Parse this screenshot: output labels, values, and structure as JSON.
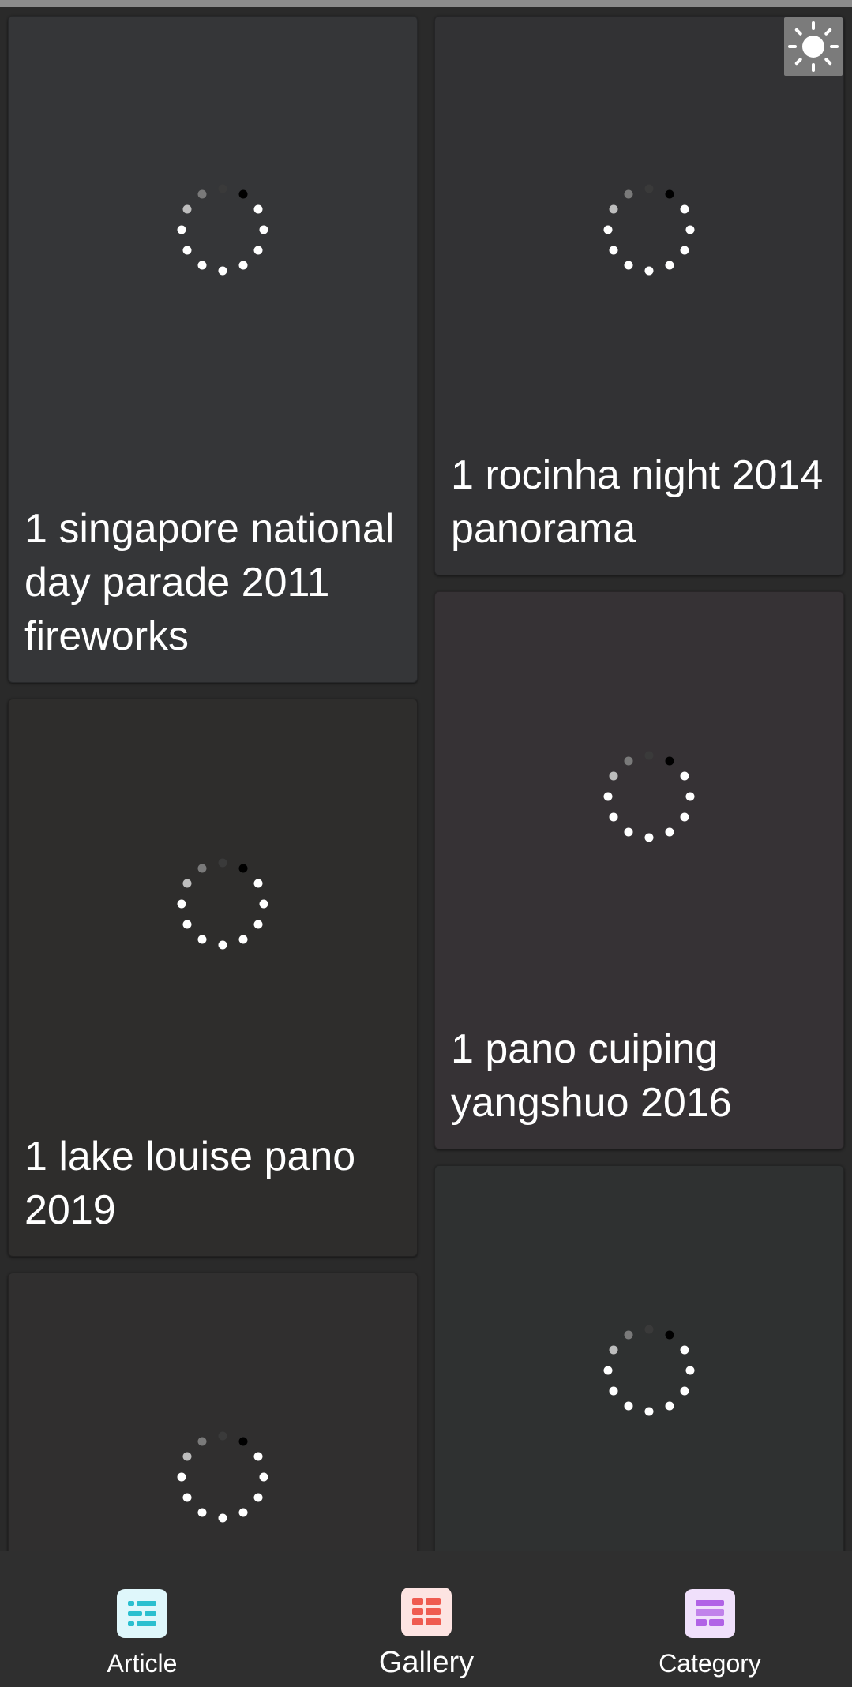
{
  "cards": [
    {
      "title": "1 singapore national day parade 2011 fireworks",
      "bg": "#353638"
    },
    {
      "title": "1 rocinha night 2014 panorama",
      "bg": "#323234"
    },
    {
      "title": "1 lake louise pano 2019",
      "bg": "#2e2d2c"
    },
    {
      "title": "1 pano cuiping yangshuo 2016",
      "bg": "#363235"
    },
    {
      "title": "",
      "bg": "#302f2f"
    },
    {
      "title": "",
      "bg": "#2f3131"
    }
  ],
  "theme_toggle": {
    "icon": "sun-icon"
  },
  "bottom_nav": {
    "items": [
      {
        "label": "Article",
        "icon": "article-icon",
        "icon_bg": "#dff7fb",
        "icon_fg": "#2bbfcf",
        "active": false
      },
      {
        "label": "Gallery",
        "icon": "gallery-icon",
        "icon_bg": "#fde4e2",
        "icon_fg": "#ef5b50",
        "active": true
      },
      {
        "label": "Category",
        "icon": "category-icon",
        "icon_bg": "#f0e0fb",
        "icon_fg": "#b163e6",
        "active": false
      }
    ]
  }
}
